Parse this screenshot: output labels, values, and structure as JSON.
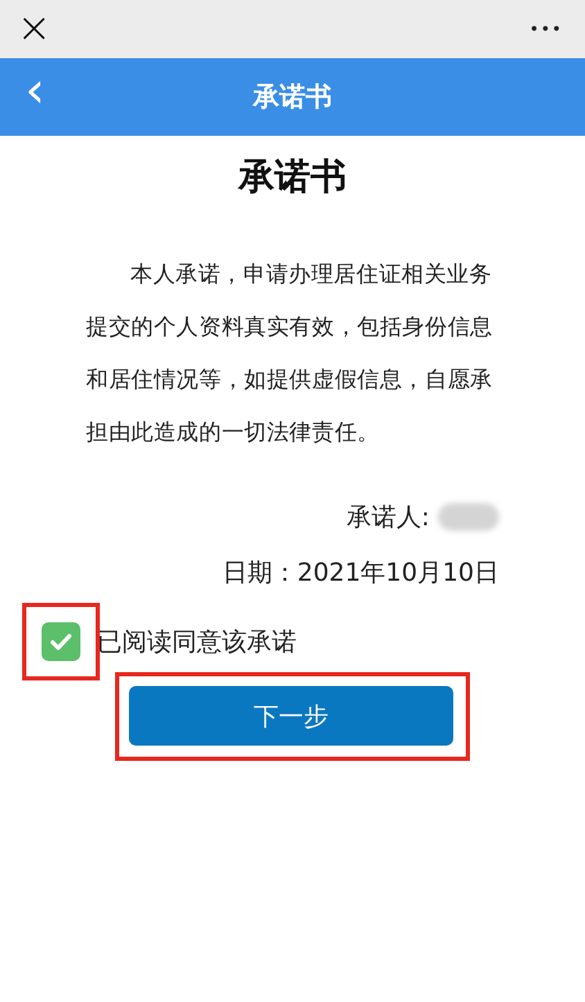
{
  "top_bar": {
    "close": "×",
    "more": "•••"
  },
  "header": {
    "back": "‹",
    "title": "承诺书"
  },
  "document": {
    "title": "承诺书",
    "body": "本人承诺，申请办理居住证相关业务提交的个人资料真实有效，包括身份信息和居住情况等，如提供虚假信息，自愿承担由此造成的一切法律责任。",
    "signer_label": "承诺人:",
    "date": "日期：2021年10月10日"
  },
  "agreement": {
    "label": "已阅读同意该承诺",
    "checked": true
  },
  "next_button": {
    "label": "下一步"
  }
}
